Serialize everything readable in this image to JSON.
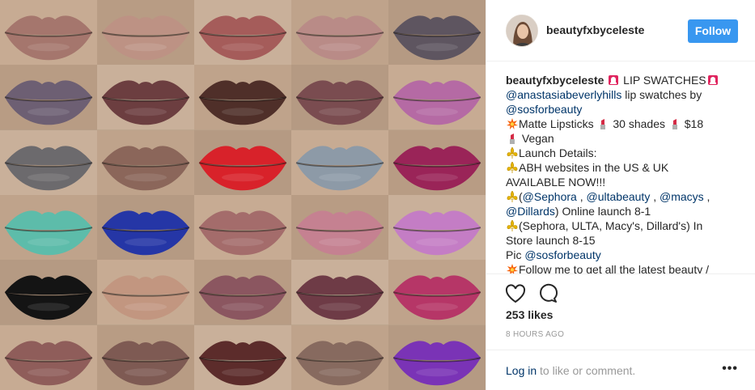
{
  "post": {
    "username": "beautyfxbyceleste",
    "follow_label": "Follow",
    "likes": "253 likes",
    "time_ago": "8 HOURS AGO",
    "login_link": "Log in",
    "login_rest": " to like or comment.",
    "more_label": "•••"
  },
  "caption": {
    "l1_user": "beautyfxbyceleste",
    "l1_text": " LIP SWATCHES",
    "l2_mention": "@anastasiabeverlyhills",
    "l2_text": " lip swatches by",
    "l3_mention": "@sosforbeauty",
    "l4_a": "Matte Lipsticks ",
    "l4_b": " 30 shades ",
    "l4_c": " $18",
    "l5_text": " Vegan",
    "l6_text": "Launch Details:",
    "l7_text": "ABH websites in the US & UK",
    "l8_text": "AVAILABLE NOW!!!",
    "l9_open": "(",
    "l9_m1": "@Sephora",
    "l9_sep1": " , ",
    "l9_m2": "@ultabeauty",
    "l9_sep2": " , ",
    "l9_m3": "@macys",
    "l9_sep3": " ,",
    "l10_m1": "@Dillards",
    "l10_text": ") Online launch 8-1",
    "l11_text": "(Sephora, ULTA, Macy's, Dillard's) In",
    "l12_text": "Store launch 8-15",
    "l13_text": "Pic ",
    "l13_mention": "@sosforbeauty",
    "l14_text": "Follow me to get all the latest beauty /"
  },
  "swatches": [
    [
      "#a5766d",
      "#bd9284",
      "#a55c5a",
      "#b98b87",
      "#5e5560"
    ],
    [
      "#6d5f73",
      "#6c3e40",
      "#4f2f29",
      "#7a4c50",
      "#b56aa4"
    ],
    [
      "#6c6a6d",
      "#8b665a",
      "#d8222a",
      "#8d9aa7",
      "#9a2458"
    ],
    [
      "#5dbcaa",
      "#2536a6",
      "#a46c6b",
      "#c58191",
      "#c47dc5"
    ],
    [
      "#141414",
      "#c29680",
      "#8b5660",
      "#6e3b46",
      "#b63667"
    ],
    [
      "#8f5d5a",
      "#7e5a53",
      "#5c2c2b",
      "#876a5f",
      "#7a33b6"
    ]
  ],
  "colors": {
    "follow_bg": "#3897f0",
    "link": "#003569",
    "muted": "#999999"
  },
  "icons": {
    "heart": "heart-icon",
    "comment": "comment-bubble-icon",
    "siren": "siren-emoji",
    "collision": "collision-emoji",
    "lipstick": "lipstick-emoji",
    "fleur": "fleur-de-lis-emoji"
  }
}
